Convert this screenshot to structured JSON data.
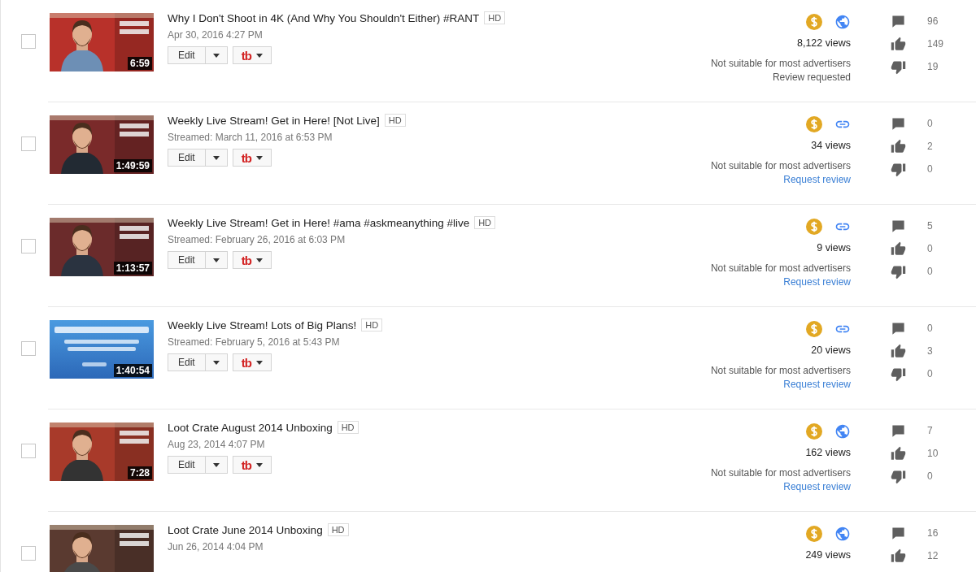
{
  "videos": [
    {
      "title": "Why I Don't Shoot in 4K (And Why You Shouldn't Either) #RANT",
      "badge": "HD",
      "date": "Apr 30, 2016 4:27 PM",
      "duration": "6:59",
      "checked": false,
      "actions": {
        "edit": "Edit",
        "addon": "tb"
      },
      "monetized": true,
      "visibility": {
        "kind": "public"
      },
      "views": "8,122 views",
      "ads": {
        "status": "Not suitable for most advertisers",
        "review": {
          "kind": "note",
          "text": "Review requested"
        }
      },
      "stats": {
        "comments": "96",
        "likes": "149",
        "dislikes": "19"
      }
    },
    {
      "title": "Weekly Live Stream! Get in Here! [Not Live]",
      "badge": "HD",
      "date": "Streamed: March 11, 2016 at 6:53 PM",
      "duration": "1:49:59",
      "checked": false,
      "actions": {
        "edit": "Edit",
        "addon": "tb"
      },
      "monetized": true,
      "visibility": {
        "kind": "unlisted"
      },
      "views": "34 views",
      "ads": {
        "status": "Not suitable for most advertisers",
        "review": {
          "kind": "link",
          "text": "Request review"
        }
      },
      "stats": {
        "comments": "0",
        "likes": "2",
        "dislikes": "0"
      }
    },
    {
      "title": "Weekly Live Stream! Get in Here! #ama #askmeanything #live",
      "badge": "HD",
      "date": "Streamed: February 26, 2016 at 6:03 PM",
      "duration": "1:13:57",
      "checked": false,
      "actions": {
        "edit": "Edit",
        "addon": "tb"
      },
      "monetized": true,
      "visibility": {
        "kind": "unlisted"
      },
      "views": "9 views",
      "ads": {
        "status": "Not suitable for most advertisers",
        "review": {
          "kind": "link",
          "text": "Request review"
        }
      },
      "stats": {
        "comments": "5",
        "likes": "0",
        "dislikes": "0"
      }
    },
    {
      "title": "Weekly Live Stream! Lots of Big Plans!",
      "badge": "HD",
      "date": "Streamed: February 5, 2016 at 5:43 PM",
      "duration": "1:40:54",
      "checked": false,
      "actions": {
        "edit": "Edit",
        "addon": "tb"
      },
      "monetized": true,
      "visibility": {
        "kind": "unlisted"
      },
      "views": "20 views",
      "ads": {
        "status": "Not suitable for most advertisers",
        "review": {
          "kind": "link",
          "text": "Request review"
        }
      },
      "stats": {
        "comments": "0",
        "likes": "3",
        "dislikes": "0"
      }
    },
    {
      "title": "Loot Crate August 2014 Unboxing",
      "badge": "HD",
      "date": "Aug 23, 2014 4:07 PM",
      "duration": "7:28",
      "checked": false,
      "actions": {
        "edit": "Edit",
        "addon": "tb"
      },
      "monetized": true,
      "visibility": {
        "kind": "public"
      },
      "views": "162 views",
      "ads": {
        "status": "Not suitable for most advertisers",
        "review": {
          "kind": "link",
          "text": "Request review"
        }
      },
      "stats": {
        "comments": "7",
        "likes": "10",
        "dislikes": "0"
      }
    },
    {
      "title": "Loot Crate June 2014 Unboxing",
      "badge": "HD",
      "date": "Jun 26, 2014 4:04 PM",
      "checked": false,
      "monetized": true,
      "visibility": {
        "kind": "public"
      },
      "views": "249 views",
      "stats": {
        "comments": "16",
        "likes": "12"
      }
    }
  ]
}
